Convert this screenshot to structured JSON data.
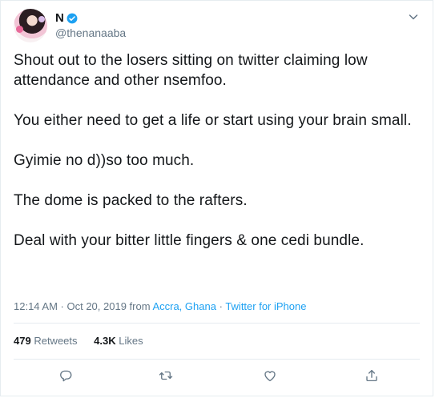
{
  "tweet": {
    "display_name": "N",
    "handle": "@thenanaaba",
    "paragraphs": [
      "Shout out to the losers sitting on twitter claiming low attendance and other nsemfoo.",
      "You either need to get a life or start using your brain small.",
      "Gyimie no d))so too much.",
      "The dome is packed to the rafters.",
      "Deal with your bitter little fingers & one cedi bundle."
    ],
    "time": "12:14 AM · Oct 20, 2019",
    "from_label": "from",
    "location": "Accra, Ghana",
    "separator": "·",
    "source": "Twitter for iPhone",
    "retweets_count": "479",
    "retweets_label": "Retweets",
    "likes_count": "4.3K",
    "likes_label": "Likes"
  },
  "icons": {
    "verified": "verified-badge-icon",
    "caret": "chevron-down-icon",
    "reply": "reply-icon",
    "retweet": "retweet-icon",
    "like": "heart-icon",
    "share": "share-icon"
  },
  "colors": {
    "accent": "#1da1f2",
    "text": "#14171a",
    "muted": "#657786",
    "border": "#e6ecf0"
  }
}
